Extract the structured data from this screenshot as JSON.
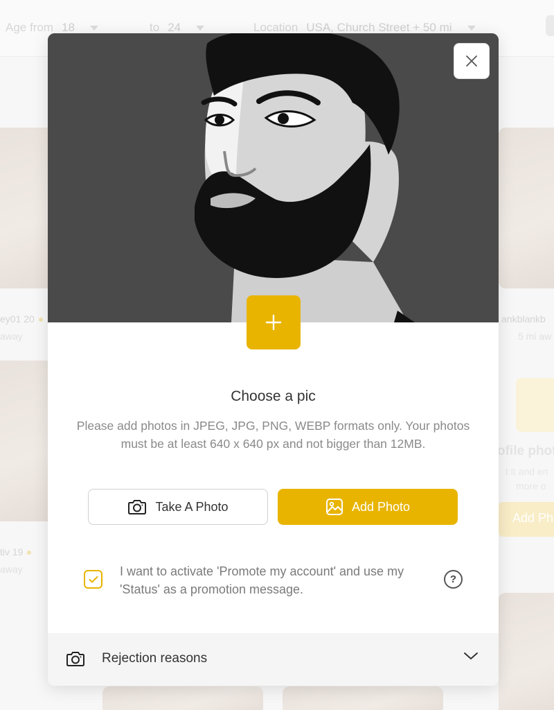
{
  "background": {
    "filters": {
      "age_from_label": "Age from",
      "age_from_value": "18",
      "age_to_label": "to",
      "age_to_value": "24",
      "location_label": "Location",
      "location_value": "USA, Church Street + 50 mi"
    },
    "cards": [
      {
        "name": "ey01 20",
        "distance": "away"
      },
      {
        "name": "ankblankb",
        "distance": "5 mi aw"
      },
      {
        "name": "tiv 19",
        "distance": "away"
      }
    ],
    "profile_photo_text": "ofile phot",
    "profile_sub1": "t it and en",
    "profile_sub2": "more o",
    "add_button_label": "Add Ph"
  },
  "modal": {
    "close_icon": "close-icon",
    "add_icon": "plus-icon",
    "title": "Choose a pic",
    "description": "Please add photos in JPEG, JPG, PNG, WEBP formats only. Your photos must be at least 640 x 640 px and not bigger than 12MB.",
    "take_photo_label": "Take A Photo",
    "add_photo_label": "Add Photo",
    "promote_text": "I want to activate 'Promote my account' and use my 'Status' as a promotion message.",
    "promote_checked": true,
    "help_label": "?",
    "rejection_label": "Rejection reasons"
  },
  "colors": {
    "accent": "#e8b400",
    "hero_bg": "#4a4a4a",
    "text_muted": "#8a8a8a"
  }
}
